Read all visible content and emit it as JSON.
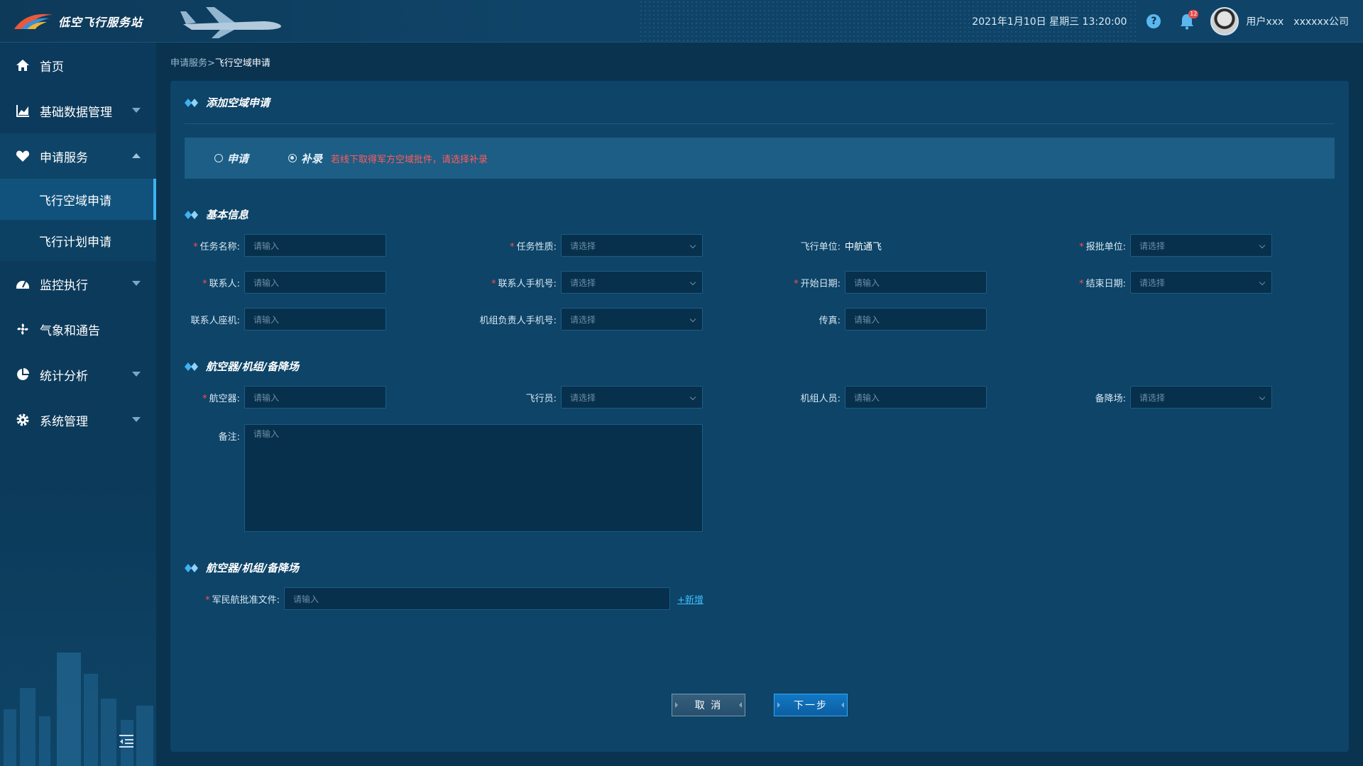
{
  "header": {
    "app_title": "低空飞行服务站",
    "datetime": "2021年1月10日  星期三  13:20:00",
    "help_icon": "?",
    "notification_count": "12",
    "user_name": "用户xxx",
    "company": "xxxxxx公司"
  },
  "sidebar": {
    "items": [
      {
        "label": "首页",
        "icon": "home-icon"
      },
      {
        "label": "基础数据管理",
        "icon": "chart-icon"
      },
      {
        "label": "申请服务",
        "icon": "heart-icon"
      },
      {
        "label": "监控执行",
        "icon": "dashboard-icon"
      },
      {
        "label": "气象和通告",
        "icon": "fan-icon"
      },
      {
        "label": "统计分析",
        "icon": "pie-icon"
      },
      {
        "label": "系统管理",
        "icon": "gear-icon"
      }
    ],
    "sub_items": [
      "飞行空域申请",
      "飞行计划申请"
    ]
  },
  "breadcrumb": {
    "parent": "申请服务>",
    "current": "飞行空域申请"
  },
  "form": {
    "title": "添加空域申请",
    "radio_apply": "申请",
    "radio_supplement": "补录",
    "supplement_hint": "若线下取得军方空域批件，请选择补录",
    "section_basic": "基本信息",
    "section_aircraft": "航空器/机组/备降场",
    "section_docs": "航空器/机组/备降场",
    "placeholders": {
      "input": "请输入",
      "select": "请选择"
    },
    "labels": {
      "task_name": "任务名称:",
      "task_nature": "任务性质:",
      "flight_unit": "飞行单位:",
      "approval_unit": "报批单位:",
      "contact": "联系人:",
      "contact_phone": "联系人手机号:",
      "start_date": "开始日期:",
      "end_date": "结束日期:",
      "contact_landline": "联系人座机:",
      "crew_leader_phone": "机组负责人手机号:",
      "fax": "传真:",
      "aircraft": "航空器:",
      "pilot": "飞行员:",
      "crew": "机组人员:",
      "alternate": "备降场:",
      "remarks": "备注:",
      "military_doc": "军民航批准文件:"
    },
    "flight_unit_value": "中航通飞",
    "add_link": "+新增",
    "cancel_button": "取 消",
    "next_button": "下一步"
  },
  "colors": {
    "accent": "#3fb2f0",
    "required": "#ff4d4d",
    "background": "#0a3350"
  }
}
